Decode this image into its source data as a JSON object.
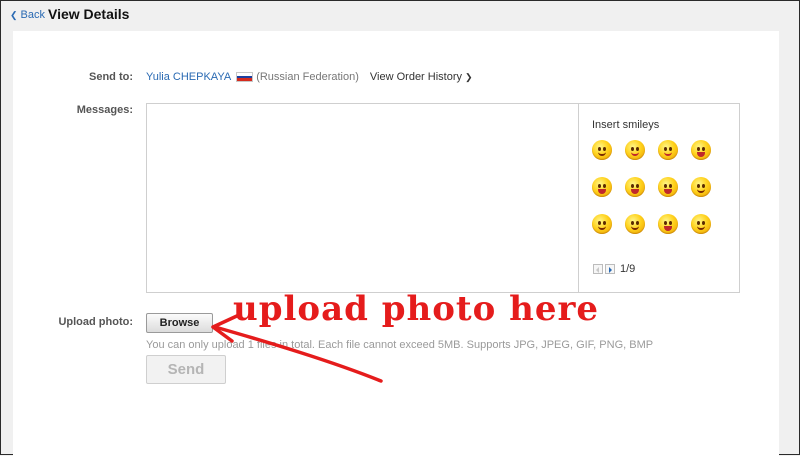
{
  "header": {
    "back_label": "Back",
    "title": "View Details"
  },
  "send_to": {
    "label": "Send to:",
    "recipient_name": "Yulia CHEPKAYA",
    "country": "(Russian Federation)",
    "order_history_link": "View Order History"
  },
  "messages": {
    "label": "Messages:",
    "value": "",
    "smileys": {
      "heading": "Insert smileys",
      "page_indicator": "1/9",
      "items": [
        "smile",
        "tongue-wink",
        "yum",
        "laugh",
        "laugh-cry",
        "shout",
        "grin-sweat",
        "wink-bow",
        "blush-hands",
        "sparkle-dizzy",
        "grin-shy",
        "thinking"
      ]
    }
  },
  "upload": {
    "label": "Upload photo:",
    "browse_label": "Browse",
    "hint": "You can only upload 1 files in total. Each file cannot exceed 5MB. Supports JPG, JPEG, GIF, PNG, BMP",
    "send_label": "Send"
  },
  "annotation": {
    "text": "upload  photo  here",
    "color": "#e51c1c"
  },
  "colors": {
    "link": "#2a6ab3",
    "flag": [
      "#ffffff",
      "#1c3fa0",
      "#d52b1e"
    ]
  }
}
